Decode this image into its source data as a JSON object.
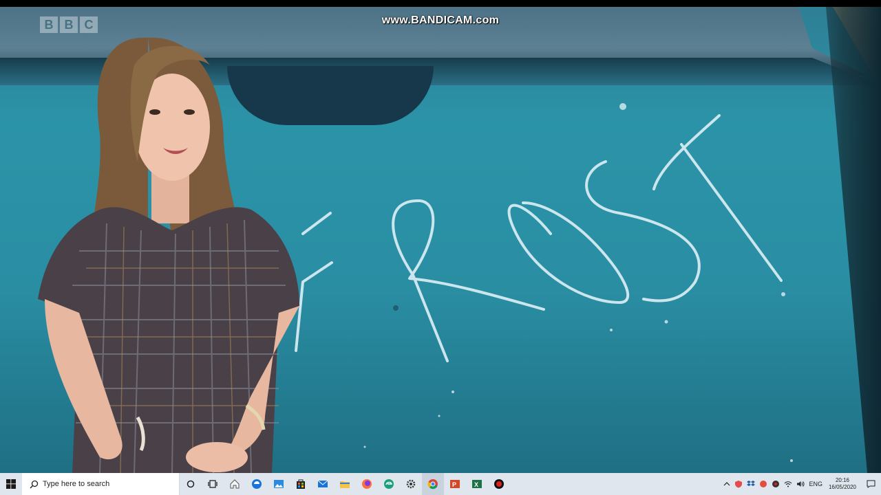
{
  "video": {
    "watermark": "www.BANDICAM.com",
    "channel_logo": [
      "B",
      "B",
      "C"
    ],
    "window_text": "FROST"
  },
  "taskbar": {
    "search_placeholder": "Type here to search",
    "apps": [
      "start-icon",
      "cortana-icon",
      "task-view-icon",
      "home-icon",
      "edge-icon",
      "photos-icon",
      "store-icon",
      "mail-icon",
      "file-explorer-icon",
      "firefox-icon",
      "edge-dev-icon",
      "settings-icon",
      "chrome-icon",
      "powerpoint-icon",
      "excel-icon",
      "bandicam-icon"
    ],
    "tray": {
      "language": "ENG",
      "time": "20:16",
      "date": "16/05/2020"
    }
  },
  "colors": {
    "window_frost": "#2a8ea3",
    "taskbar_bg": "#dfe6ee"
  }
}
